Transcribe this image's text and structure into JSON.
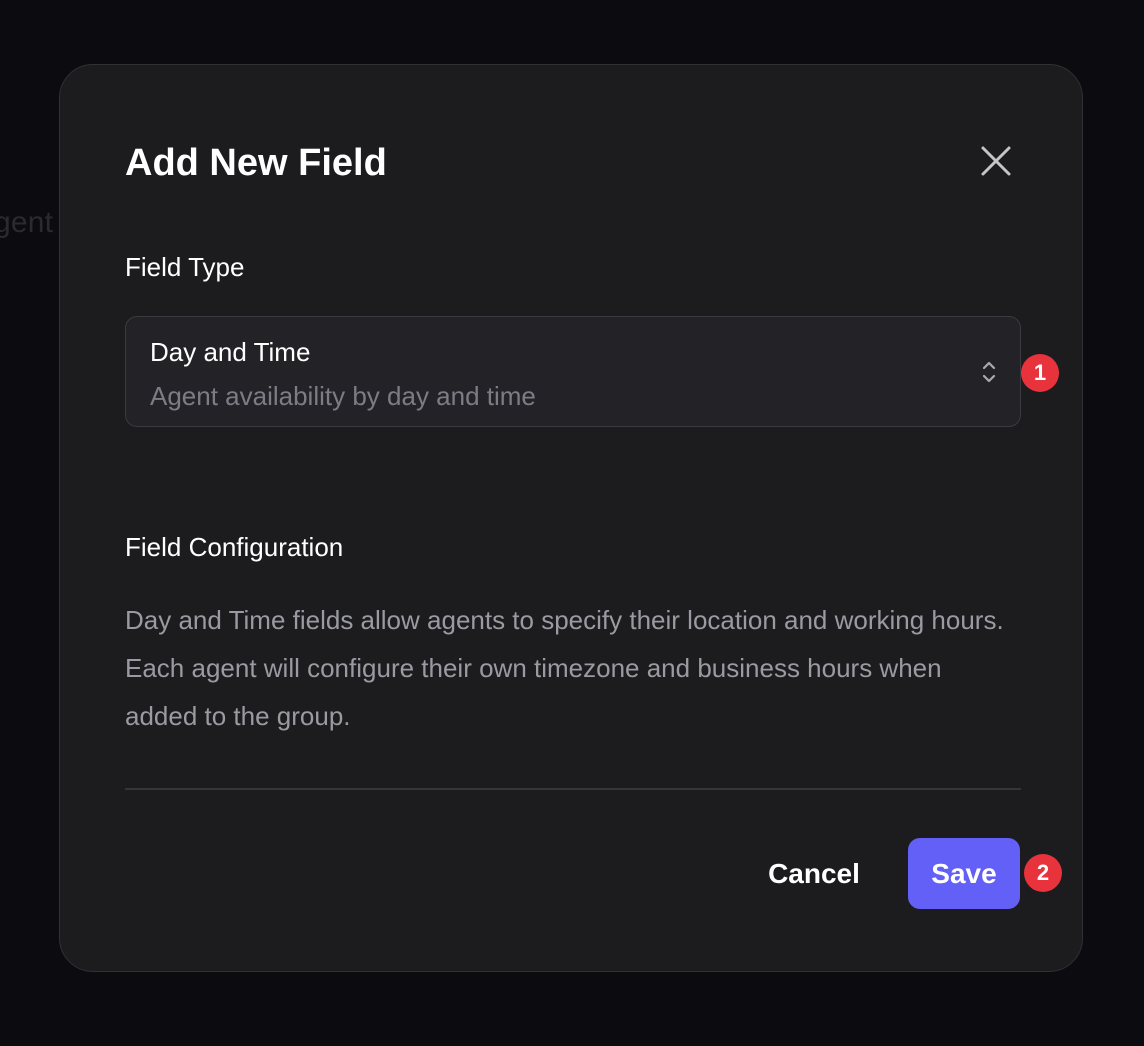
{
  "background": {
    "fragment_text": "gent"
  },
  "modal": {
    "title": "Add New Field",
    "close_icon": "close-icon",
    "field_type": {
      "label": "Field Type",
      "selected_value": "Day and Time",
      "selected_description": "Agent availability by day and time",
      "chevron_icon": "chevron-up-down-icon"
    },
    "configuration": {
      "label": "Field Configuration",
      "description": "Day and Time fields allow agents to specify their location and working hours. Each agent will configure their own timezone and business hours when added to the group."
    },
    "actions": {
      "cancel_label": "Cancel",
      "save_label": "Save"
    }
  },
  "annotations": {
    "badge_1": "1",
    "badge_2": "2"
  },
  "colors": {
    "page_background": "#0c0c10",
    "modal_background": "#1c1c1f",
    "accent": "#6360f7",
    "badge": "#e8333d",
    "muted_text": "#9a9aa2"
  }
}
